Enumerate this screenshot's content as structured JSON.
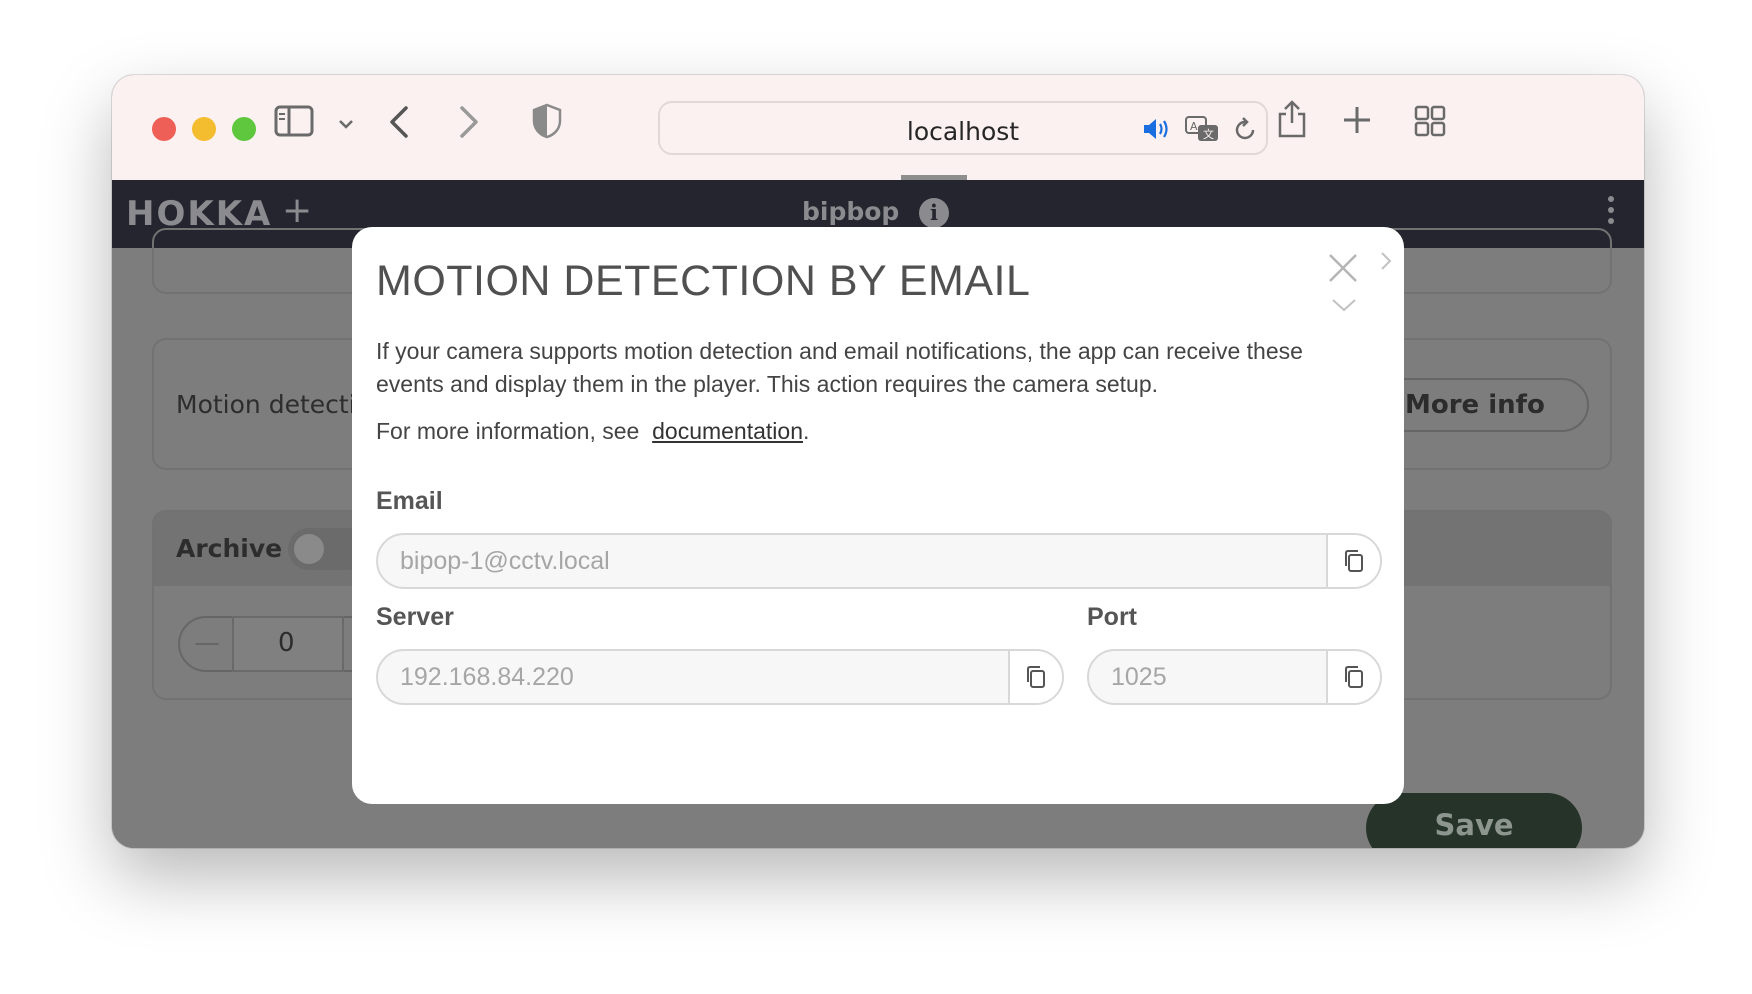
{
  "browser": {
    "url": "localhost",
    "colors": {
      "toolbar_bg": "#fbf1f0",
      "red": "#ee5f57",
      "yellow": "#f4bd30",
      "green": "#5fc73e"
    },
    "icons": [
      "sidebar-toggle-icon",
      "chevron-down-icon",
      "back-icon",
      "forward-icon",
      "shield-icon",
      "speaker-icon",
      "translate-icon",
      "reload-icon",
      "share-icon",
      "new-tab-icon",
      "tab-overview-icon"
    ]
  },
  "app": {
    "logo": "HOKKA",
    "add_tab": "+",
    "camera_name": "bipbop",
    "info_glyph": "i",
    "header_color": "#24252f"
  },
  "background_page": {
    "motion_label": "Motion detectio",
    "more_info_label": "More info",
    "archive_label": "Archive",
    "stepper_minus": "—",
    "stepper_value": "0",
    "save_label": "Save"
  },
  "modal": {
    "title": "MOTION DETECTION BY EMAIL",
    "description": "If your camera supports motion detection and email notifications, the app can receive these events and display them in the player. This action requires the camera setup.",
    "more_info_prefix": "For more information, see",
    "documentation_link": "documentation",
    "more_info_suffix": ".",
    "email": {
      "label": "Email",
      "value": "bipop-1@cctv.local"
    },
    "server": {
      "label": "Server",
      "value": "192.168.84.220"
    },
    "port": {
      "label": "Port",
      "value": "1025"
    }
  }
}
